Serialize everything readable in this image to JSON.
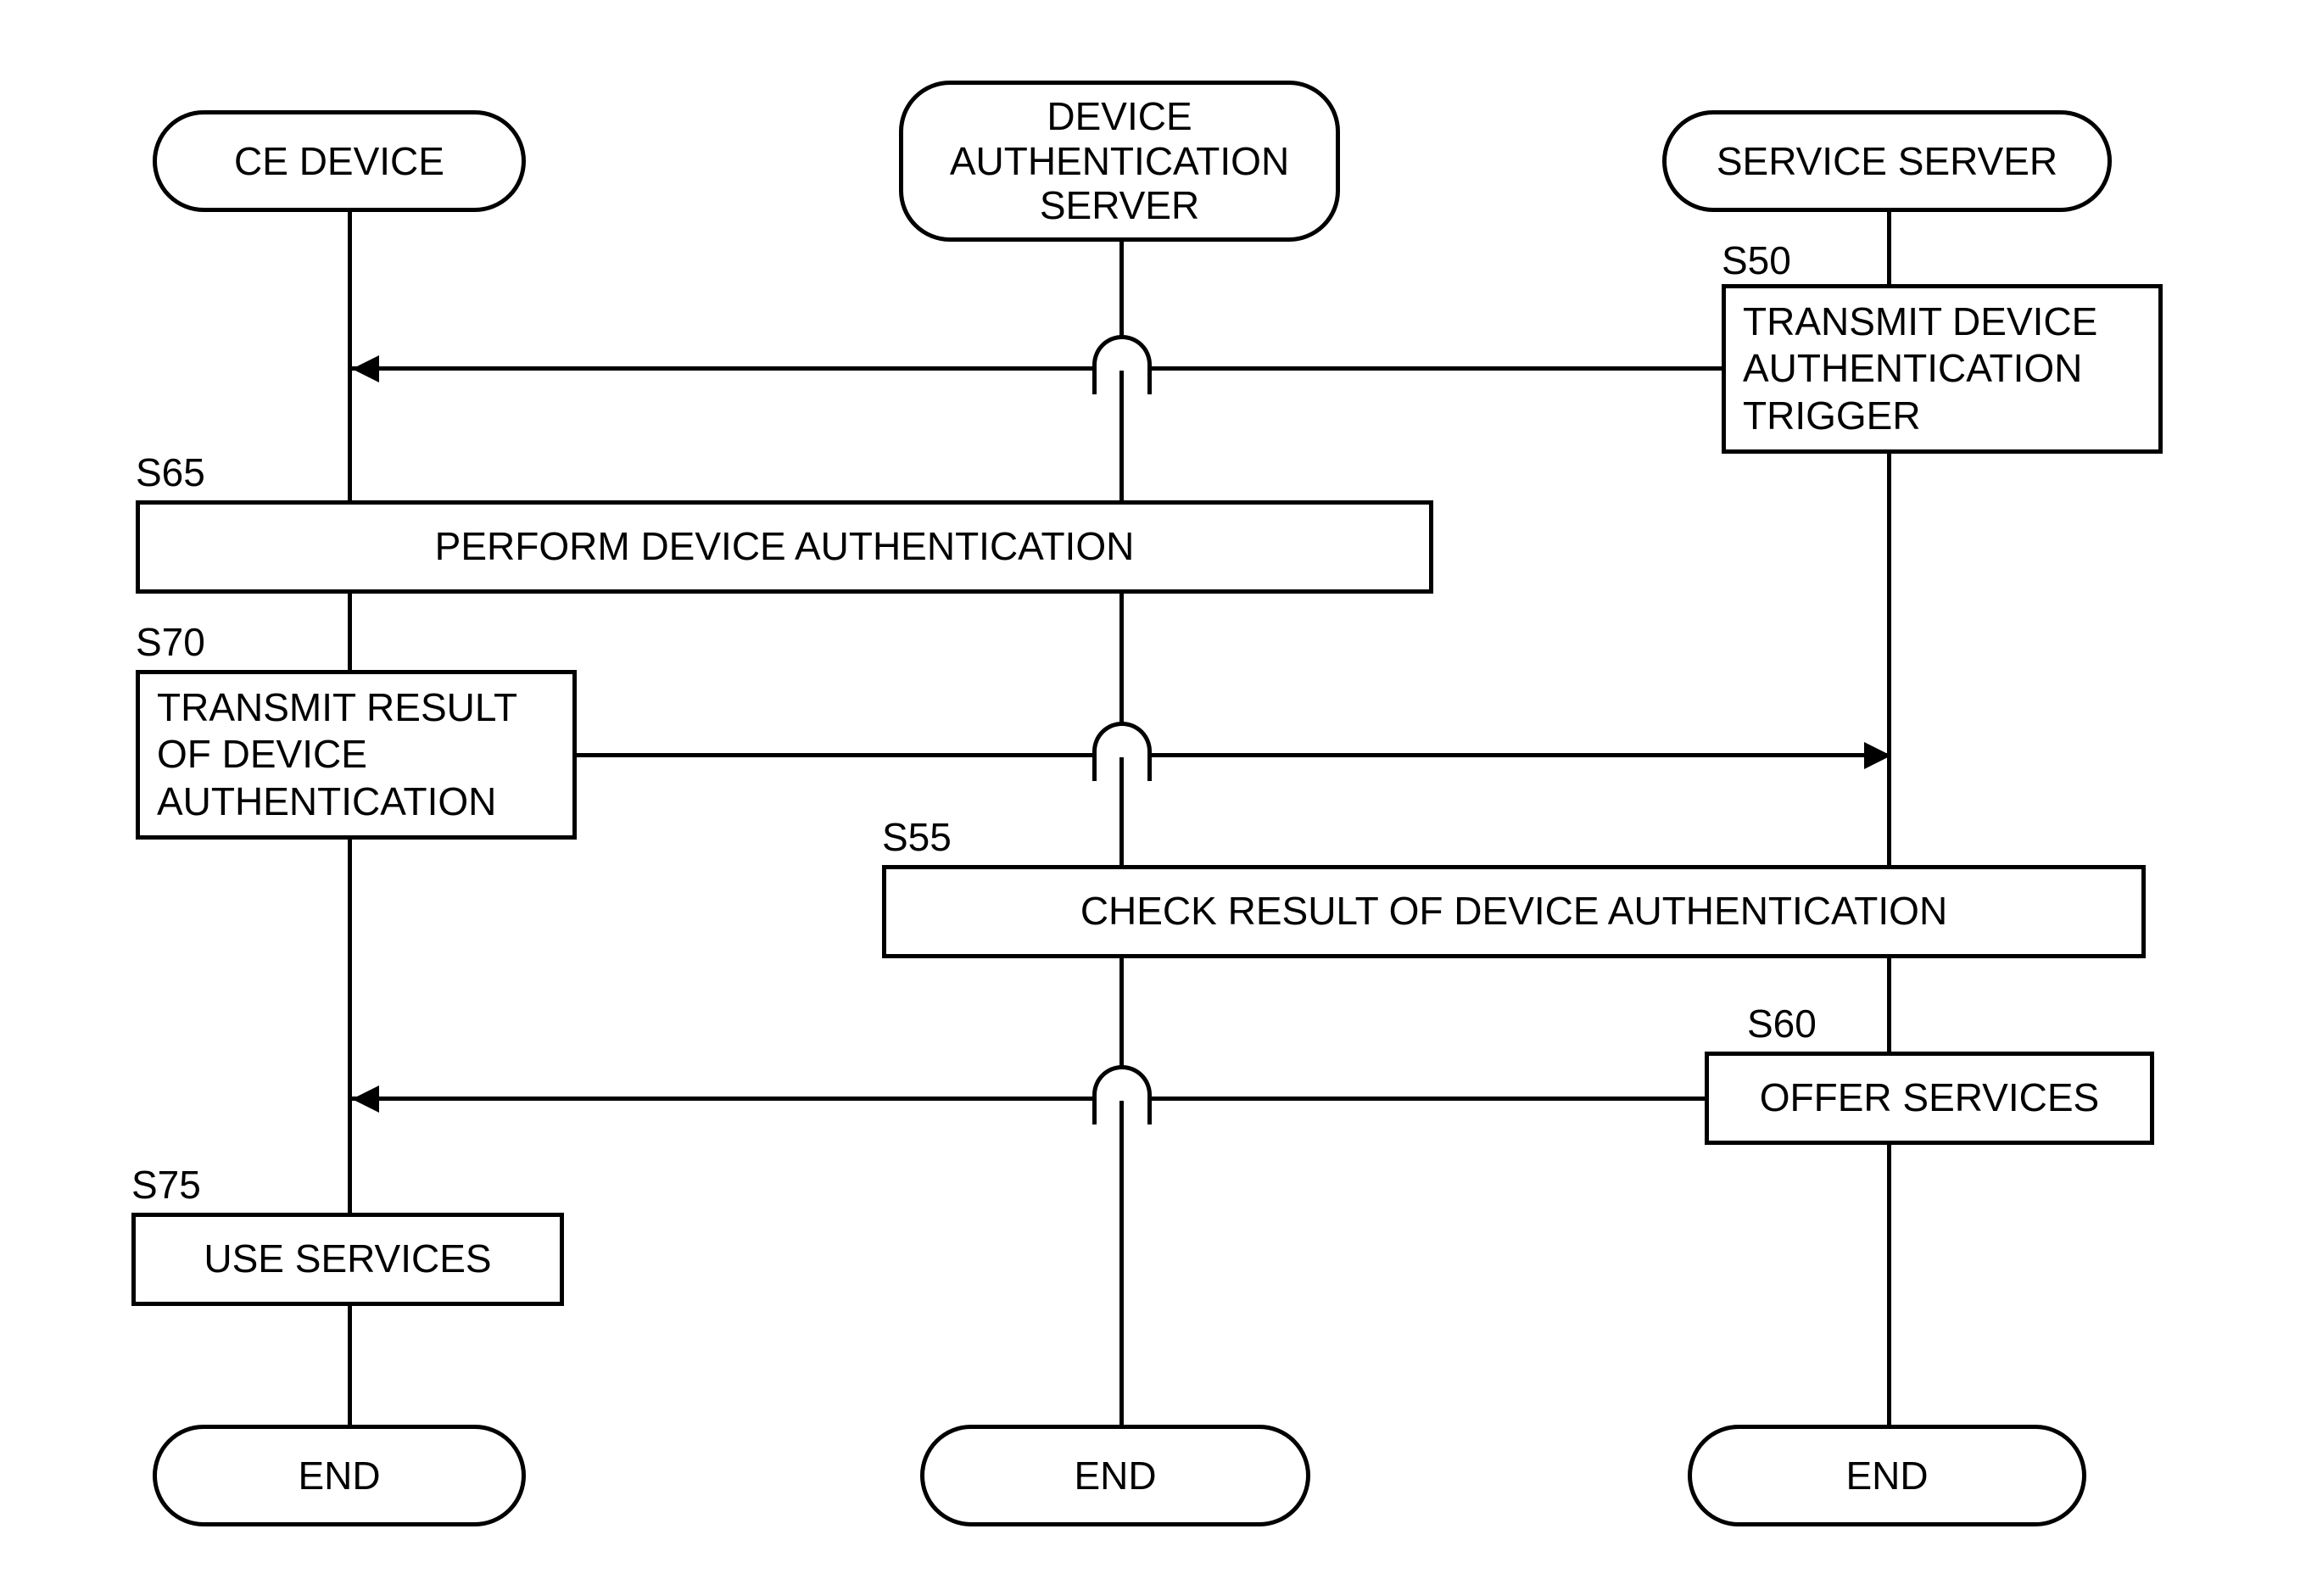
{
  "lanes": {
    "ce": {
      "title": "CE DEVICE",
      "end": "END"
    },
    "auth": {
      "title": "DEVICE\nAUTHENTICATION\nSERVER",
      "end": "END"
    },
    "service": {
      "title": "SERVICE SERVER",
      "end": "END"
    }
  },
  "steps": {
    "s50": {
      "id": "S50",
      "text": "TRANSMIT DEVICE\nAUTHENTICATION\nTRIGGER"
    },
    "s55": {
      "id": "S55",
      "text": "CHECK RESULT OF DEVICE AUTHENTICATION"
    },
    "s60": {
      "id": "S60",
      "text": "OFFER SERVICES"
    },
    "s65": {
      "id": "S65",
      "text": "PERFORM DEVICE AUTHENTICATION"
    },
    "s70": {
      "id": "S70",
      "text": "TRANSMIT RESULT\nOF DEVICE\nAUTHENTICATION"
    },
    "s75": {
      "id": "S75",
      "text": "USE SERVICES"
    }
  }
}
